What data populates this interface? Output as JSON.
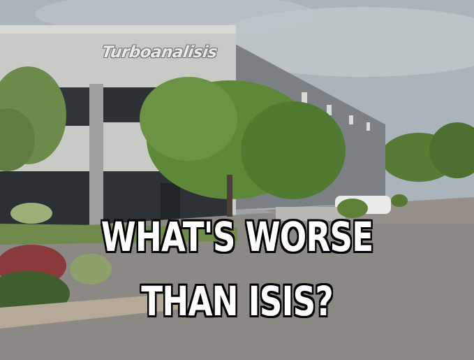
{
  "meme": {
    "caption_line1": "WHAT'S WORSE",
    "caption_line2": "THAN ISIS?"
  },
  "building": {
    "sign_text": "Turboanalisis"
  },
  "colors": {
    "sky": "#aeb7bd",
    "building_wall": "#c9cbc8",
    "building_dark": "#6f7478",
    "tree_green": "#5f8a3a",
    "road": "#8e8a86",
    "caption_fill": "#ffffff",
    "caption_outline": "#000000"
  }
}
